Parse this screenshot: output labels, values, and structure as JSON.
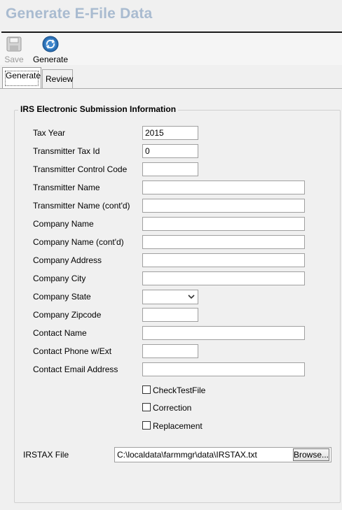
{
  "page_title": "Generate E-File Data",
  "toolbar": {
    "save_label": "Save",
    "generate_label": "Generate"
  },
  "tabs": [
    {
      "label": "Generate",
      "active": true
    },
    {
      "label": "Review",
      "active": false
    }
  ],
  "group": {
    "title": "IRS Electronic Submission Information",
    "fields": [
      {
        "label": "Tax Year",
        "value": "2015"
      },
      {
        "label": "Transmitter Tax Id",
        "value": "0"
      },
      {
        "label": "Transmitter Control Code",
        "value": ""
      },
      {
        "label": "Transmitter Name",
        "value": ""
      },
      {
        "label": "Transmitter Name (cont'd)",
        "value": ""
      },
      {
        "label": "Company Name",
        "value": ""
      },
      {
        "label": "Company Name (cont'd)",
        "value": ""
      },
      {
        "label": "Company Address",
        "value": ""
      },
      {
        "label": "Company City",
        "value": ""
      },
      {
        "label": "Company State",
        "value": ""
      },
      {
        "label": "Company Zipcode",
        "value": ""
      },
      {
        "label": "Contact Name",
        "value": ""
      },
      {
        "label": "Contact Phone w/Ext",
        "value": ""
      },
      {
        "label": "Contact Email Address",
        "value": ""
      }
    ],
    "checkboxes": [
      {
        "label": "CheckTestFile",
        "checked": false
      },
      {
        "label": "Correction",
        "checked": false
      },
      {
        "label": "Replacement",
        "checked": false
      }
    ]
  },
  "irstax": {
    "label": "IRSTAX File",
    "value": "C:\\localdata\\farmmgr\\data\\IRSTAX.txt",
    "browse_label": "Browse..."
  },
  "colors": {
    "title": "#a9bbd0",
    "generate_icon": "#2a6fb3"
  }
}
